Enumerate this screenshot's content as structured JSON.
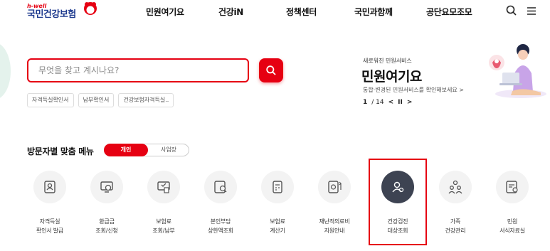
{
  "header": {
    "logo_small": "h-well",
    "logo_main": "국민건강보험",
    "nav": [
      "민원여기요",
      "건강iN",
      "정책센터",
      "국민과함께",
      "공단요모조모"
    ],
    "icons": [
      "search-icon",
      "menu-icon"
    ]
  },
  "search": {
    "placeholder": "무엇을 찾고 계시나요?",
    "value": "",
    "quick_links": [
      "자격득실확인서",
      "납부확인서",
      "건강보험자격득실.."
    ]
  },
  "banner": {
    "subtitle": "새로워진 민원서비스",
    "title": "민원여기요",
    "description": "통합·변경된 민원서비스를 확인해보세요 >",
    "page_current": "1",
    "page_total": "/ 14",
    "prev": "<",
    "pause": "II",
    "next": ">"
  },
  "visitor_menu": {
    "title": "방문자별 맞춤 메뉴",
    "tab_personal": "개인",
    "tab_business": "사업장",
    "items": [
      {
        "line1": "자격득실",
        "line2": "확인서 발급",
        "icon": "certificate-icon"
      },
      {
        "line1": "환급금",
        "line2": "조회/신청",
        "icon": "refund-monitor-icon"
      },
      {
        "line1": "보험료",
        "line2": "조회/납부",
        "icon": "premium-monitor-icon"
      },
      {
        "line1": "본인부담",
        "line2": "상한액조회",
        "icon": "copay-search-icon"
      },
      {
        "line1": "보험료",
        "line2": "계산기",
        "icon": "calculator-icon"
      },
      {
        "line1": "재난적의료비",
        "line2": "지원안내",
        "icon": "medical-support-icon"
      },
      {
        "line1": "건강검진",
        "line2": "대상조회",
        "icon": "health-checkup-icon"
      },
      {
        "line1": "가족",
        "line2": "건강관리",
        "icon": "family-icon"
      },
      {
        "line1": "민원",
        "line2": "서식자료실",
        "icon": "forms-icon"
      }
    ]
  },
  "colors": {
    "accent": "#e60012",
    "logo_blue": "#1f3b8f",
    "active_circle": "#3d4352",
    "icon_circle": "#f3f3f3"
  }
}
